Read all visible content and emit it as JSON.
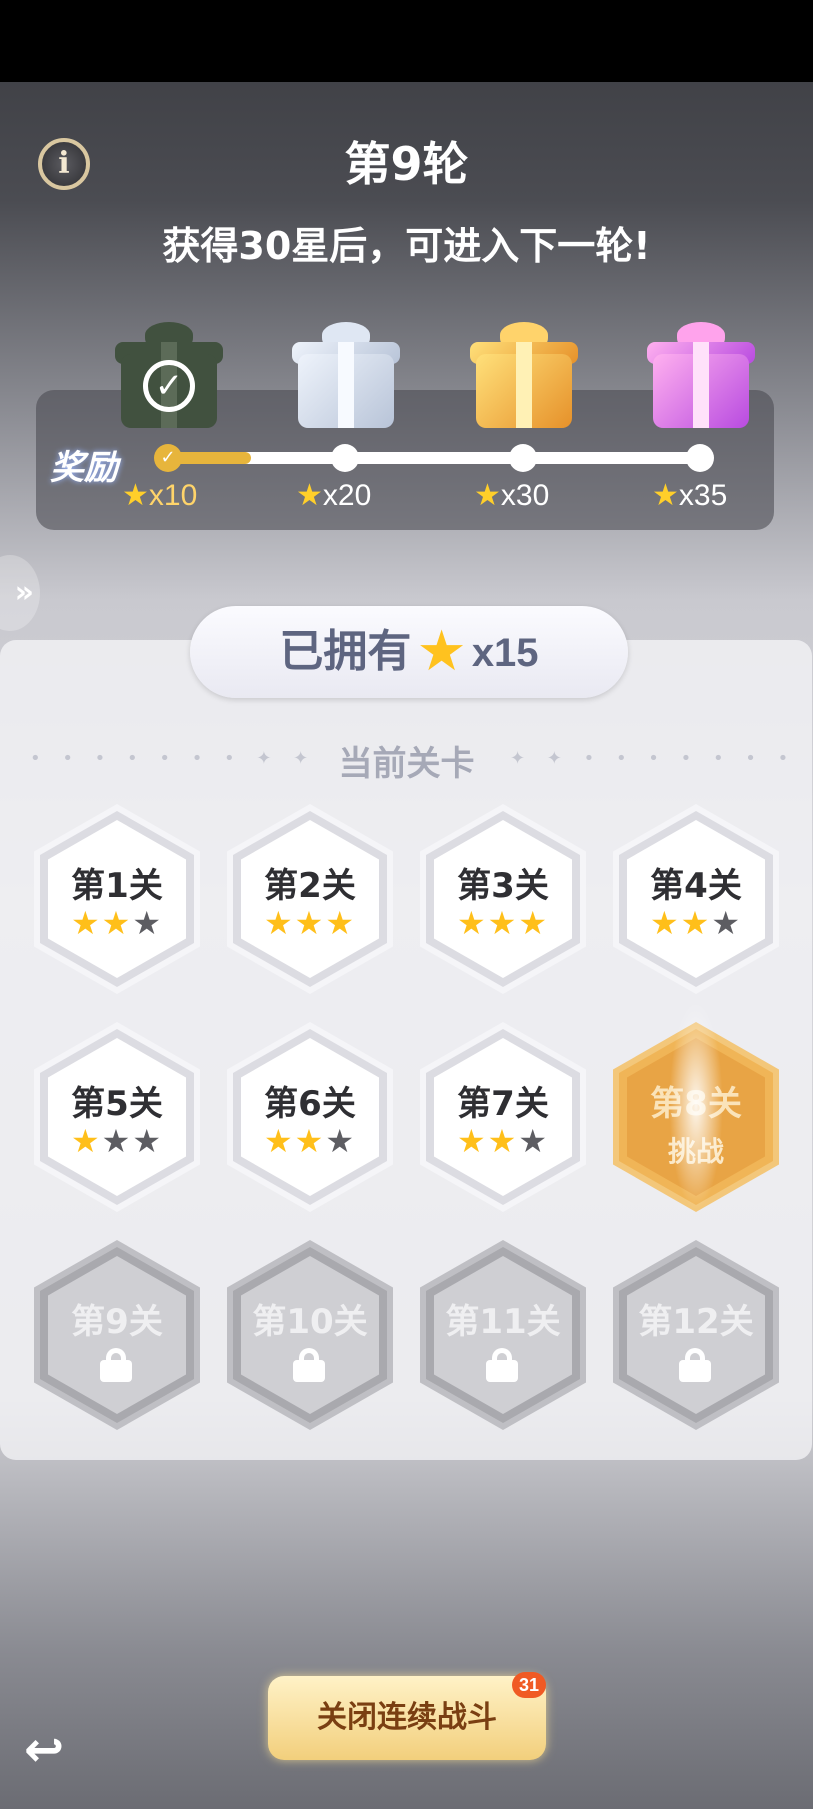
{
  "header": {
    "round_title": "第9轮",
    "subtitle": "获得30星后，可进入下一轮!",
    "info_icon": "i"
  },
  "rewards": {
    "label": "奖励",
    "progress_fraction": 0.15,
    "tiers": [
      {
        "stars": "x10",
        "gift": "green-gift-icon",
        "claimed": true
      },
      {
        "stars": "x20",
        "gift": "silver-gift-icon",
        "claimed": false
      },
      {
        "stars": "x30",
        "gift": "gold-gift-icon",
        "claimed": false
      },
      {
        "stars": "x35",
        "gift": "pink-gift-icon",
        "claimed": false
      }
    ]
  },
  "owned": {
    "label": "已拥有",
    "count": "x15"
  },
  "current_label": "当前关卡",
  "levels": [
    {
      "name": "第1关",
      "stars": 2,
      "state": "done"
    },
    {
      "name": "第2关",
      "stars": 3,
      "state": "done"
    },
    {
      "name": "第3关",
      "stars": 3,
      "state": "done"
    },
    {
      "name": "第4关",
      "stars": 2,
      "state": "done"
    },
    {
      "name": "第5关",
      "stars": 1,
      "state": "done"
    },
    {
      "name": "第6关",
      "stars": 2,
      "state": "done"
    },
    {
      "name": "第7关",
      "stars": 2,
      "state": "done"
    },
    {
      "name": "第8关",
      "sub": "挑战",
      "state": "current"
    },
    {
      "name": "第9关",
      "state": "locked"
    },
    {
      "name": "第10关",
      "state": "locked"
    },
    {
      "name": "第11关",
      "state": "locked"
    },
    {
      "name": "第12关",
      "state": "locked"
    }
  ],
  "footer": {
    "close_button": "关闭连续战斗",
    "badge": "31"
  },
  "colors": {
    "star_on": "#ffbf1a",
    "star_off": "#5d5d62",
    "progress": "#e7b53c",
    "close_button_text": "#7a3f12"
  }
}
